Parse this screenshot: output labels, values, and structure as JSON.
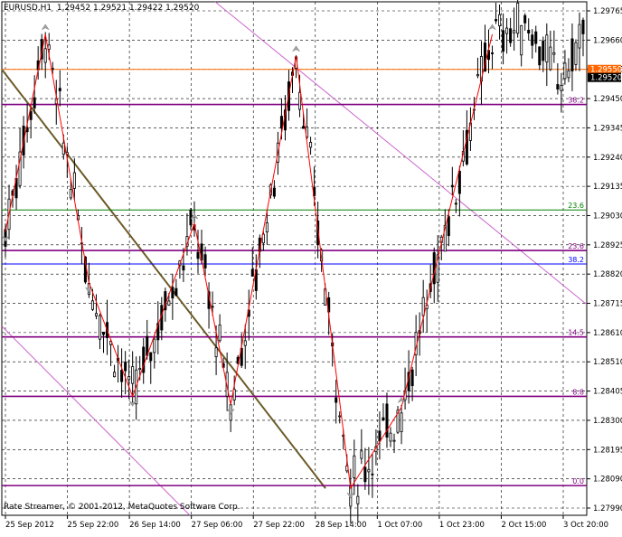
{
  "header": {
    "symbol": "EURUSD,H1",
    "ohlc": "1.29452 1.29521 1.29422 1.29520"
  },
  "footer": {
    "credit": "Rate Streamer, © 2001-2012, MetaQuotes Software Corp."
  },
  "colors": {
    "candle": "#000000",
    "zigzag": "#ff0000",
    "fibo_purple": "#800080",
    "fibo_green": "#008000",
    "fibo_blue": "#0000ff",
    "resistance": "#ff6600",
    "channel": "#cc66cc",
    "trend": "#556b2f",
    "fractal": "#a0a0a0",
    "grid": "#000000"
  },
  "chart_data": {
    "type": "candlestick",
    "symbol": "EURUSD",
    "timeframe": "H1",
    "ylim": [
      1.279,
      1.298
    ],
    "y_ticks": [
      "1.29765",
      "1.29660",
      "1.29555",
      "1.29450",
      "1.29345",
      "1.29240",
      "1.29135",
      "1.29030",
      "1.28925",
      "1.28820",
      "1.28715",
      "1.28610",
      "1.28510",
      "1.28405",
      "1.28300",
      "1.28195",
      "1.28090",
      "1.27990"
    ],
    "x_ticks": [
      "25 Sep 2012",
      "25 Sep 22:00",
      "26 Sep 14:00",
      "27 Sep 06:00",
      "27 Sep 22:00",
      "28 Sep 14:00",
      "1 Oct 07:00",
      "1 Oct 23:00",
      "2 Oct 15:00",
      "3 Oct 20:00"
    ],
    "price_labels": [
      {
        "value": 1.2955,
        "text": "1.29550",
        "color": "#ff6600"
      },
      {
        "value": 1.2952,
        "text": "1.29520",
        "color": "#000000"
      }
    ],
    "levels": [
      {
        "value": 1.2955,
        "label": "",
        "color": "#ff6600"
      },
      {
        "value": 1.2942,
        "label": "38.2",
        "color": "#800080"
      },
      {
        "value": 1.2903,
        "label": "23.6",
        "color": "#008000"
      },
      {
        "value": 1.2888,
        "label": "23.6",
        "color": "#800080"
      },
      {
        "value": 1.2883,
        "label": "38.2",
        "color": "#0000ff"
      },
      {
        "value": 1.2856,
        "label": "14.5",
        "color": "#800080"
      },
      {
        "value": 1.2834,
        "label": "8.8",
        "color": "#800080"
      },
      {
        "value": 1.2801,
        "label": "0.0",
        "color": "#800080"
      }
    ],
    "zigzag": [
      [
        0,
        1.2895
      ],
      [
        11,
        1.2968
      ],
      [
        23,
        1.2876
      ],
      [
        35,
        1.2834
      ],
      [
        52,
        1.2898
      ],
      [
        62,
        1.2831
      ],
      [
        80,
        1.296
      ],
      [
        95,
        1.28
      ],
      [
        109,
        1.283
      ],
      [
        134,
        1.2968
      ]
    ],
    "candle_count": 160
  }
}
